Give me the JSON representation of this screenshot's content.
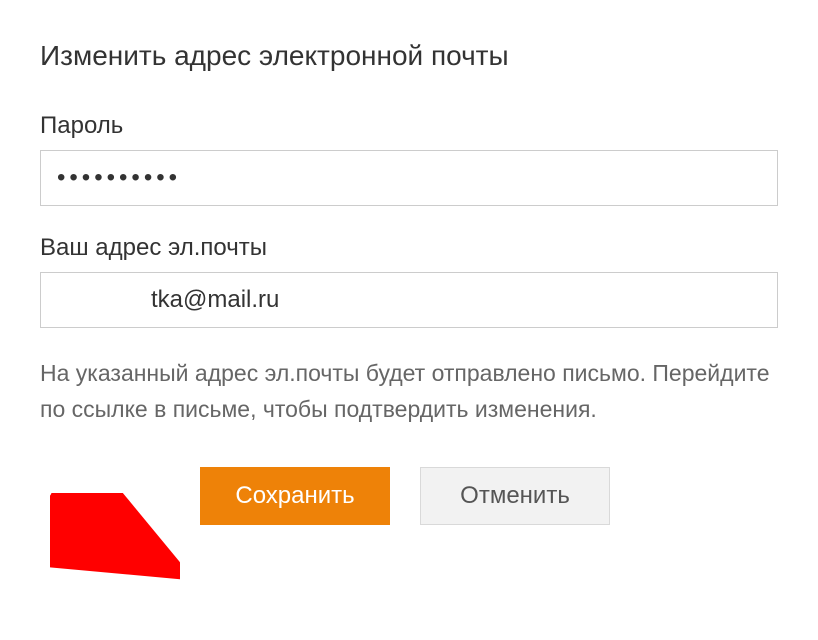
{
  "form": {
    "title": "Изменить адрес электронной почты",
    "password": {
      "label": "Пароль",
      "value": "••••••••••"
    },
    "email": {
      "label": "Ваш адрес эл.почты",
      "value": "tka@mail.ru"
    },
    "help_text": "На указанный адрес эл.почты будет отправлено письмо. Перейдите по ссылке в письме, чтобы подтвердить изменения."
  },
  "buttons": {
    "save": "Сохранить",
    "cancel": "Отменить"
  },
  "colors": {
    "primary": "#ee8208",
    "arrow": "#ff0000"
  }
}
